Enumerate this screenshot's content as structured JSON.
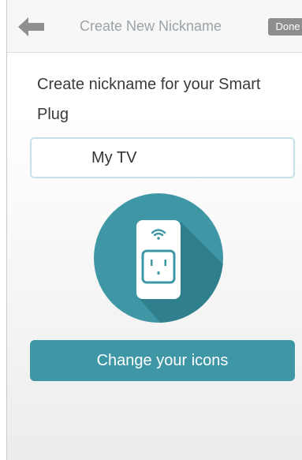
{
  "header": {
    "title": "Create New Nickname",
    "done_label": "Done",
    "back_icon": "back-arrow-icon"
  },
  "prompt": {
    "line1": "Create nickname for your Smart",
    "line2": "Plug"
  },
  "nickname_input": {
    "value": "My TV"
  },
  "device_icon": {
    "name": "smart-plug-icon",
    "accent_color": "#3f97a6"
  },
  "change_icons_button": {
    "label": "Change your icons"
  },
  "colors": {
    "accent": "#3f97a6",
    "title_text": "#9aa3a8",
    "done_button": "#8e8e8e"
  }
}
